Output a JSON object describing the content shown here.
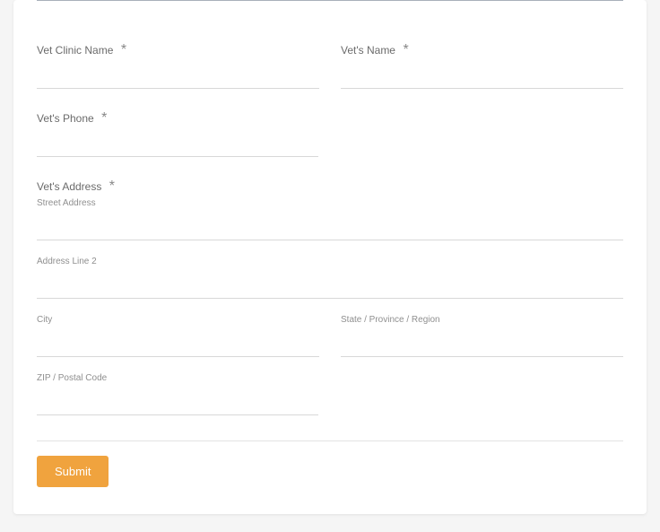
{
  "fields": {
    "clinic_name": {
      "label": "Vet Clinic Name",
      "required": "*"
    },
    "vet_name": {
      "label": "Vet's Name",
      "required": "*"
    },
    "vet_phone": {
      "label": "Vet's Phone",
      "required": "*"
    },
    "vet_address": {
      "label": "Vet's Address",
      "required": "*"
    }
  },
  "address": {
    "street": "Street Address",
    "line2": "Address Line 2",
    "city": "City",
    "state": "State / Province / Region",
    "zip": "ZIP / Postal Code"
  },
  "submit_label": "Submit"
}
